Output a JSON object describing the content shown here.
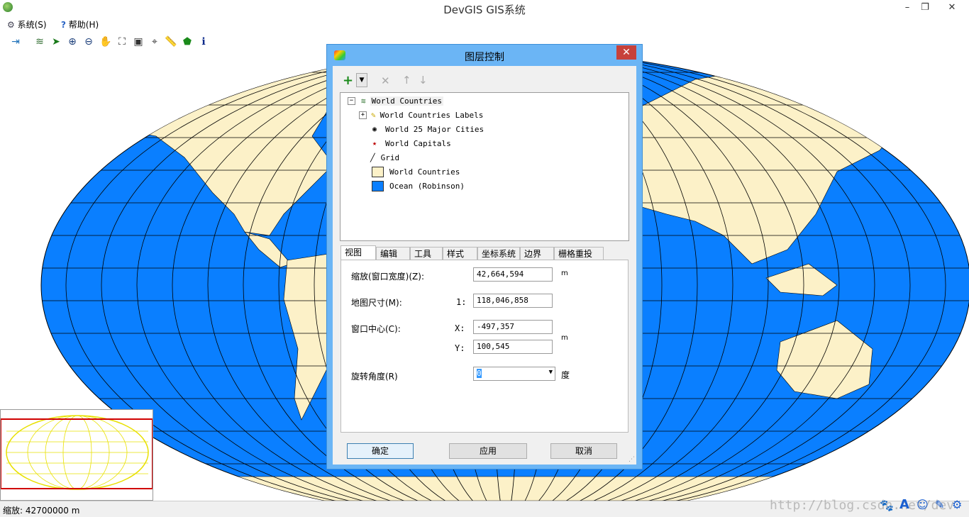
{
  "window": {
    "title": "DevGIS GIS系统"
  },
  "menu": {
    "items": [
      {
        "label": "系统(S)"
      },
      {
        "label": "帮助(H)"
      }
    ]
  },
  "toolbar": {
    "tools": [
      "exit-icon",
      "layers-icon",
      "select-arrow-icon",
      "zoom-in-icon",
      "zoom-out-icon",
      "pan-hand-icon",
      "zoom-extent-icon",
      "zoom-full-icon",
      "crosshair-icon",
      "measure-icon",
      "polygon-icon",
      "info-icon"
    ]
  },
  "dialog": {
    "title": "图层控制",
    "tree": [
      {
        "label": "World Countries",
        "level": 0
      },
      {
        "label": "World Countries Labels",
        "level": 1
      },
      {
        "label": "World 25 Major Cities",
        "level": 1
      },
      {
        "label": "World Capitals",
        "level": 1
      },
      {
        "label": "Grid",
        "level": 1
      },
      {
        "label": "World Countries",
        "level": 1
      },
      {
        "label": "Ocean (Robinson)",
        "level": 1
      }
    ],
    "tabs": [
      "视图",
      "编辑",
      "工具",
      "样式",
      "坐标系统",
      "边界",
      "栅格重投影"
    ],
    "view": {
      "scale_label": "缩放(窗口宽度)(Z):",
      "scale_value": "42,664,594",
      "scale_unit": "m",
      "mapsize_label": "地图尺寸(M):",
      "mapsize_prefix": "1:",
      "mapsize_value": "118,046,858",
      "center_label": "窗口中心(C):",
      "center_x_prefix": "X:",
      "center_x_value": "-497,357",
      "center_y_prefix": "Y:",
      "center_y_value": "100,545",
      "center_unit": "m",
      "rotation_label": "旋转角度(R)",
      "rotation_value": "0",
      "rotation_unit": "度"
    },
    "buttons": {
      "ok": "确定",
      "apply": "应用",
      "cancel": "取消"
    }
  },
  "colors": {
    "ocean": "#0a7fff",
    "land": "#fcf1c8",
    "dialog_border": "#6bb5f5",
    "close": "#c7413a"
  },
  "status": {
    "scale_text": "缩放: 42700000 m"
  },
  "watermark": "http://blog.csdn.net/dev"
}
